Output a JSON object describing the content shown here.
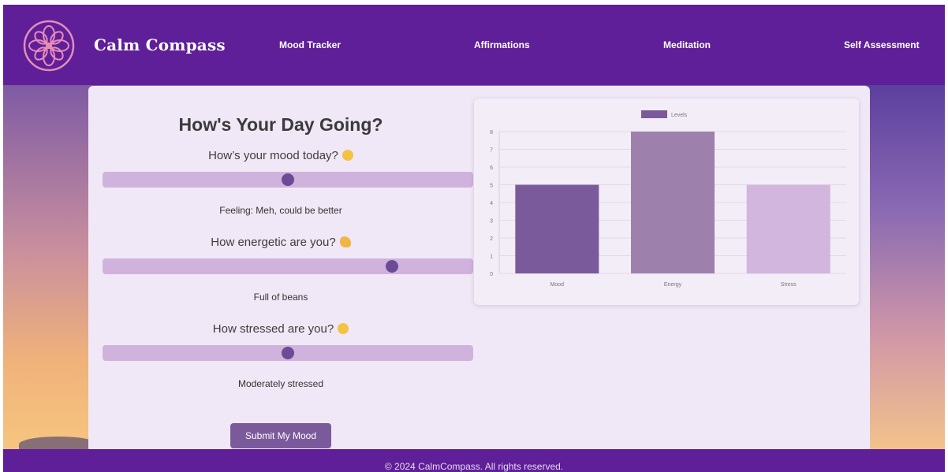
{
  "header": {
    "brand": "Calm Compass",
    "nav": [
      "Mood Tracker",
      "Affirmations",
      "Meditation",
      "Self Assessment"
    ]
  },
  "form": {
    "title": "How's Your Day Going?",
    "questions": [
      {
        "label": "How’s your mood today?",
        "emoji": "grinning-face",
        "value": 0.5,
        "feedback": "Feeling: Meh, could be better"
      },
      {
        "label": "How energetic are you?",
        "emoji": "flexed-biceps",
        "value": 0.78,
        "feedback": "Full of beans"
      },
      {
        "label": "How stressed are you?",
        "emoji": "grimacing-face",
        "value": 0.5,
        "feedback": "Moderately stressed"
      }
    ],
    "submit_label": "Submit My Mood"
  },
  "chart_data": {
    "type": "bar",
    "categories": [
      "Mood",
      "Energy",
      "Stress"
    ],
    "series": [
      {
        "name": "Levels",
        "values": [
          5,
          8,
          5
        ]
      }
    ],
    "colors": [
      "#7a5a9b",
      "#9e80ad",
      "#d2b6dd"
    ],
    "ylim": [
      0,
      8
    ],
    "yticks": [
      "0",
      "1",
      "2",
      "3",
      "4",
      "5",
      "6",
      "7",
      "8"
    ],
    "legend_position": "top",
    "grid": true
  },
  "footer": {
    "text": "© 2024 CalmCompass. All rights reserved."
  },
  "colors": {
    "nav_bg": "#5f1f98",
    "card_bg": "#f0e8f6",
    "slider_track": "#cfb3dd",
    "slider_thumb": "#6b4a96",
    "button_bg": "#7b5a9b",
    "logo_stroke": "#e58cb8"
  }
}
